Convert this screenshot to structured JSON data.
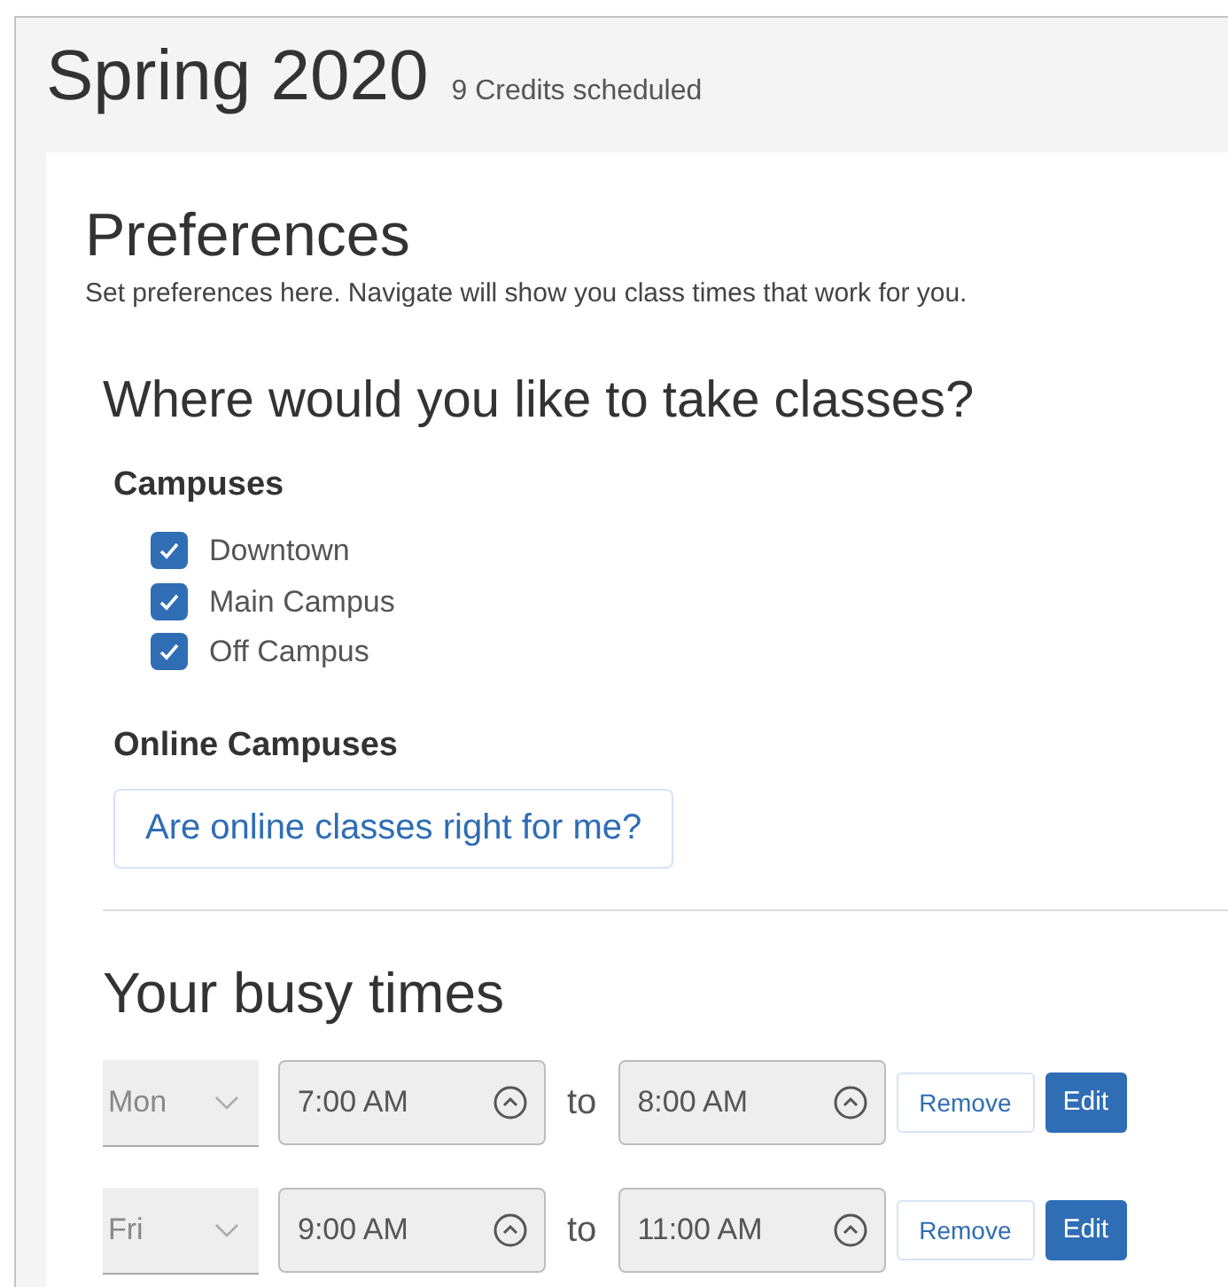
{
  "term": {
    "title": "Spring 2020",
    "credits": "9 Credits scheduled"
  },
  "preferences": {
    "title": "Preferences",
    "subtitle": "Set preferences here. Navigate will show you class times that work for you.",
    "location_heading": "Where would you like to take classes?",
    "campuses": {
      "heading": "Campuses",
      "items": [
        {
          "label": "Downtown",
          "checked": true
        },
        {
          "label": "Main Campus",
          "checked": true
        },
        {
          "label": "Off Campus",
          "checked": true
        }
      ]
    },
    "online": {
      "heading": "Online Campuses",
      "link": "Are online classes right for me?"
    },
    "busy_times": {
      "heading": "Your busy times",
      "rows": [
        {
          "day": "Mon",
          "start": "7:00 AM",
          "separator": "to",
          "end": "8:00 AM",
          "remove": "Remove",
          "edit": "Edit"
        },
        {
          "day": "Fri",
          "start": "9:00 AM",
          "separator": "to",
          "end": "11:00 AM",
          "remove": "Remove",
          "edit": "Edit"
        }
      ]
    }
  }
}
